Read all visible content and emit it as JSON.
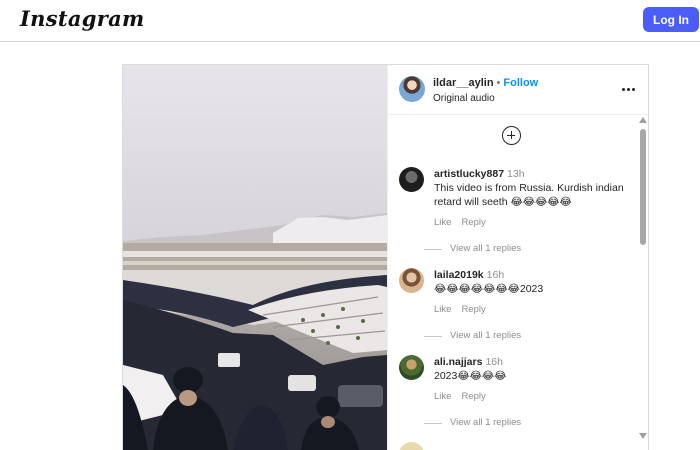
{
  "topbar": {
    "logo": "Instagram",
    "login_label": "Log In"
  },
  "post": {
    "username": "ildar__aylin",
    "separator": "•",
    "follow_label": "Follow",
    "audio": "Original audio",
    "comments": [
      {
        "user": "artistlucky887",
        "time": "13h",
        "text": "This video is from Russia. Kurdish indian retard will seeth 😂😂😂😂😂",
        "like": "Like",
        "reply": "Reply",
        "view_replies": "View all 1 replies"
      },
      {
        "user": "laila2019k",
        "time": "16h",
        "text": "😂😂😂😂😂😂😂2023",
        "like": "Like",
        "reply": "Reply",
        "view_replies": "View all 1 replies"
      },
      {
        "user": "ali.najjars",
        "time": "16h",
        "text": "2023😂😂😂😂",
        "like": "Like",
        "reply": "Reply",
        "view_replies": "View all 1 replies"
      }
    ]
  },
  "colors": {
    "accent": "#4a5df9",
    "follow": "#0095f6",
    "border": "#dbdbdb"
  }
}
